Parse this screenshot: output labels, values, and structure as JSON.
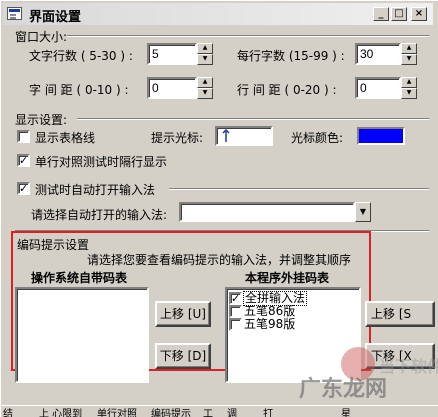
{
  "window": {
    "title": "界面设置",
    "min_label": "_",
    "max_label": "□",
    "close_label": "×"
  },
  "window_size_group": {
    "title": "窗口大小:",
    "text_rows_label": "文字行数 ( 5-30 ) :",
    "text_rows_value": "5",
    "chars_per_row_label": "每行字数 (15-99 ) :",
    "chars_per_row_value": "30",
    "char_spacing_label": "字 间 距 ( 0-10 ) :",
    "char_spacing_value": "0",
    "line_spacing_label": "行 间 距 ( 0-20 ) :",
    "line_spacing_value": "0"
  },
  "display_group": {
    "title": "显示设置:",
    "show_gridlines_label": "显示表格线",
    "show_gridlines_checked": false,
    "cursor_hint_label": "提示光标:",
    "cursor_color_label": "光标颜色:",
    "cursor_color": "#0000ff",
    "alternate_row_label": "单行对照测试时隔行显示",
    "alternate_row_checked": true
  },
  "ime_group": {
    "auto_open_label": "测试时自动打开输入法",
    "auto_open_checked": true,
    "select_ime_label": "请选择自动打开的输入法:",
    "select_ime_value": ""
  },
  "encoding_group": {
    "title": "编码提示设置",
    "instruction": "请选择您要查看编码提示的输入法，并调整其顺序",
    "os_list_title": "操作系统自带码表",
    "plugin_list_title": "本程序外挂码表",
    "move_up_label": "上移 [U]",
    "move_down_label": "下移 [D]",
    "move_up_right_label": "上移 [S",
    "move_down_right_label": "下移 [X",
    "plugin_items": [
      {
        "label": "全拼输入法",
        "checked": true
      },
      {
        "label": "五笔86版",
        "checked": false
      },
      {
        "label": "五笔98版",
        "checked": false
      }
    ]
  },
  "watermark": {
    "line1": "当下软件园",
    "line2": "广东龙网"
  },
  "taskbar": {
    "items": [
      "结",
      "上 心限到",
      "单行对照",
      "编码提示",
      "工",
      "调",
      "打",
      "星"
    ]
  }
}
